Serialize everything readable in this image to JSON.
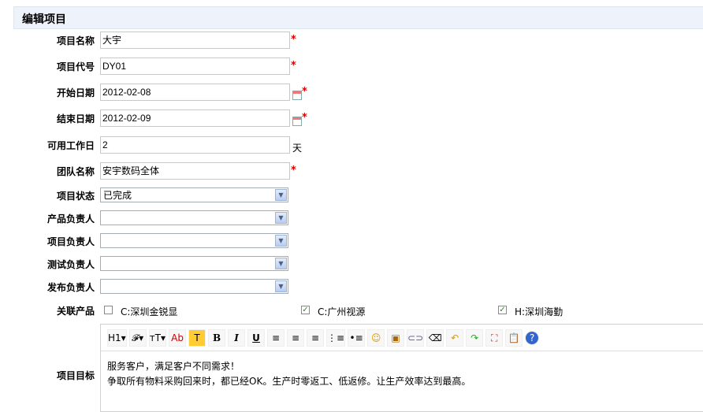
{
  "header": {
    "title": "编辑项目"
  },
  "fields": {
    "name": {
      "label": "项目名称",
      "value": "大宇"
    },
    "code": {
      "label": "项目代号",
      "value": "DY01"
    },
    "start": {
      "label": "开始日期",
      "value": "2012-02-08"
    },
    "end": {
      "label": "结束日期",
      "value": "2012-02-09"
    },
    "days": {
      "label": "可用工作日",
      "value": "2",
      "unit": "天"
    },
    "team": {
      "label": "团队名称",
      "value": "安宇数码全体"
    },
    "status": {
      "label": "项目状态",
      "value": "已完成"
    },
    "product_owner": {
      "label": "产品负责人",
      "value": ""
    },
    "project_owner": {
      "label": "项目负责人",
      "value": ""
    },
    "test_owner": {
      "label": "测试负责人",
      "value": ""
    },
    "release_owner": {
      "label": "发布负责人",
      "value": ""
    }
  },
  "required_mark": "*",
  "products": {
    "label": "关联产品",
    "items": [
      {
        "name": "C:深圳金锐显",
        "checked": false
      },
      {
        "name": "C:广州视源",
        "checked": true
      },
      {
        "name": "H:深圳海勤",
        "checked": true
      }
    ]
  },
  "goal": {
    "label": "项目目标",
    "toolbar": [
      "H1▾",
      "𝓕▾",
      "ᴛT▾",
      "Ab",
      "T",
      "B",
      "I",
      "U",
      "≡",
      "≡",
      "≡",
      "⋮≡",
      "•≡",
      "☺",
      "▣",
      "⊂⊃",
      "⌫",
      "↶",
      "↷",
      "⛶",
      "📋",
      "?"
    ],
    "lines": [
      "服务客户，满足客户不同需求！",
      "争取所有物料采购回来时，都已经OK。生产时零返工、低返修。让生产效率达到最高。"
    ]
  }
}
